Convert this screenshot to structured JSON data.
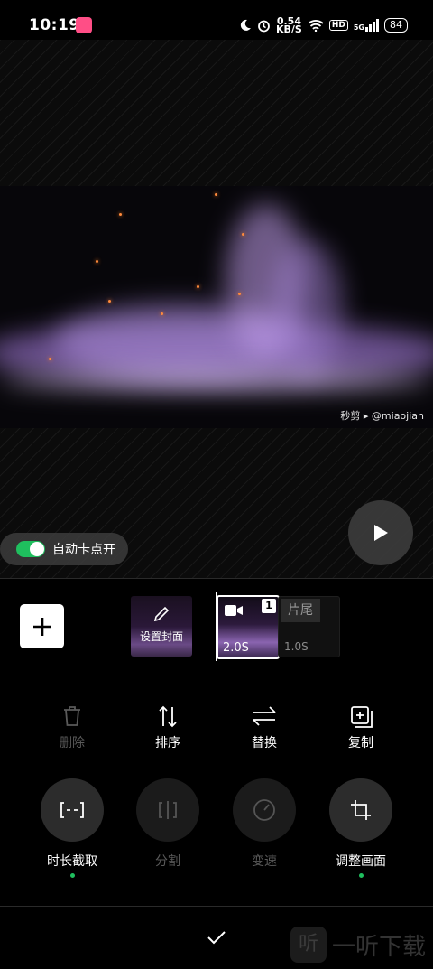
{
  "status_bar": {
    "time": "10:19",
    "network_speed_value": "0.54",
    "network_speed_unit": "KB/S",
    "hd_label": "HD",
    "signal_label": "5G",
    "battery": "84"
  },
  "preview": {
    "watermark": "秒剪 ▸ @miaojian",
    "auto_beat_label": "自动卡点开",
    "auto_beat_on": true
  },
  "timeline": {
    "cover_label": "设置封面",
    "clip_index": "1",
    "clip_duration": "2.0S",
    "tail_label": "片尾",
    "tail_duration": "1.0S"
  },
  "tools_row1": [
    {
      "label": "删除",
      "enabled": false,
      "icon": "trash-icon"
    },
    {
      "label": "排序",
      "enabled": true,
      "icon": "sort-icon"
    },
    {
      "label": "替换",
      "enabled": true,
      "icon": "swap-icon"
    },
    {
      "label": "复制",
      "enabled": true,
      "icon": "copy-icon"
    }
  ],
  "tools_row2": [
    {
      "label": "时长截取",
      "enabled": true,
      "active": true,
      "icon": "trim-icon"
    },
    {
      "label": "分割",
      "enabled": false,
      "active": false,
      "icon": "split-icon"
    },
    {
      "label": "变速",
      "enabled": false,
      "active": false,
      "icon": "speed-icon"
    },
    {
      "label": "调整画面",
      "enabled": true,
      "active": true,
      "icon": "crop-icon"
    }
  ],
  "watermark_site": "一听下载",
  "colors": {
    "accent_green": "#1fbf5e",
    "background": "#000000"
  }
}
